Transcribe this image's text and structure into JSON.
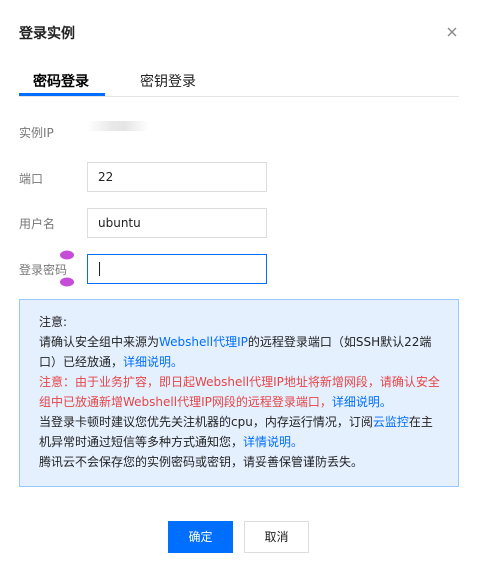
{
  "dialog": {
    "title": "登录实例",
    "close_icon": "close-icon"
  },
  "tabs": [
    {
      "label": "密码登录",
      "active": true
    },
    {
      "label": "密钥登录",
      "active": false
    }
  ],
  "form": {
    "ip_label": "实例IP",
    "port_label": "端口",
    "port_value": "22",
    "username_label": "用户名",
    "username_value": "ubuntu",
    "password_label": "登录密码",
    "password_value": ""
  },
  "notice": {
    "heading": "注意:",
    "line1_a": "请确认安全组中来源为",
    "line1_link": "Webshell代理IP",
    "line1_b": "的远程登录端口（如SSH默认22端口）已经放通，",
    "line1_link2": "详细说明。",
    "warn_a": "注意：由于业务扩容，即日起Webshell代理IP地址将新增网段，请确认安全组中已放通新增Webshell代理IP网段的远程登录端口，",
    "warn_link": "详细说明。",
    "line3_a": "当登录卡顿时建议您优先关注机器的cpu，内存运行情况，订阅",
    "line3_link": "云监控",
    "line3_b": "在主机异常时通过短信等多种方式通知您，",
    "line3_link2": "详情说明。",
    "line4": "腾讯云不会保存您的实例密码或密钥，请妥善保管谨防丢失。"
  },
  "footer": {
    "confirm_label": "确定",
    "cancel_label": "取消"
  },
  "colors": {
    "accent": "#006eff",
    "warning": "#e54545",
    "notice_bg": "#e5f0ff",
    "notice_border": "#97c7ff"
  }
}
